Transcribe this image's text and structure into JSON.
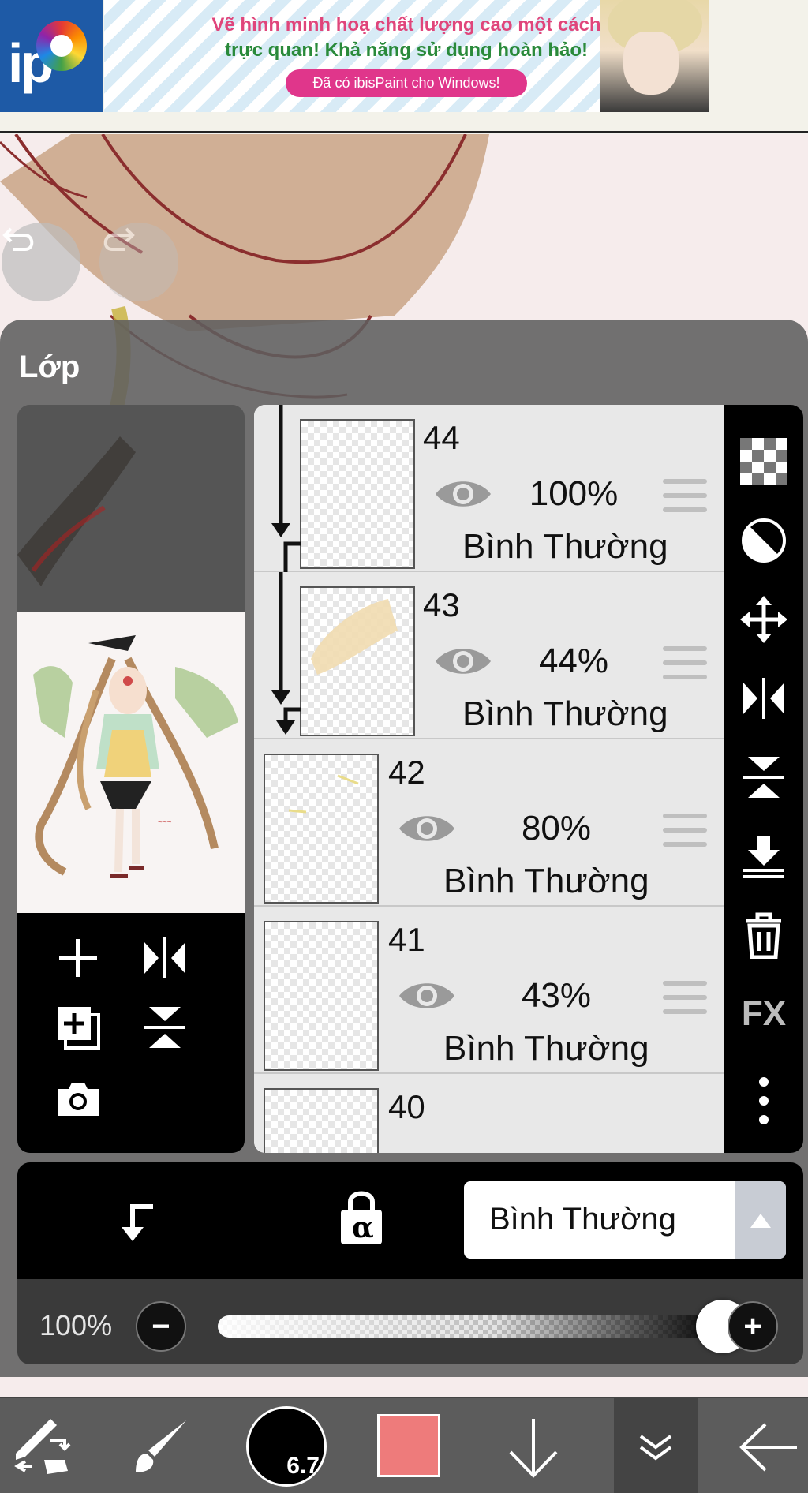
{
  "ad": {
    "line1": "Vẽ hình minh hoạ chất lượng cao một cách",
    "line2": "trực quan! Khả năng sử dụng hoàn hảo!",
    "cta": "Đã có ibisPaint cho Windows!",
    "logo_text": "ip"
  },
  "canvas": {
    "undo_icon": "undo-icon",
    "redo_icon": "redo-icon"
  },
  "layer_panel": {
    "title": "Lớp",
    "layers": [
      {
        "number": "44",
        "opacity": "100%",
        "blend": "Bình Thường",
        "visible": true,
        "clipped": true
      },
      {
        "number": "43",
        "opacity": "44%",
        "blend": "Bình Thường",
        "visible": true,
        "clipped": true
      },
      {
        "number": "42",
        "opacity": "80%",
        "blend": "Bình Thường",
        "visible": true,
        "clipped": false
      },
      {
        "number": "41",
        "opacity": "43%",
        "blend": "Bình Thường",
        "visible": true,
        "clipped": false
      },
      {
        "number": "40",
        "opacity": "",
        "blend": "",
        "visible": true,
        "clipped": false
      }
    ],
    "right_tools": [
      "transparency-icon",
      "mask-icon",
      "move-icon",
      "flip-horizontal-icon",
      "flip-vertical-icon",
      "merge-down-icon",
      "trash-icon",
      "fx-icon",
      "more-icon"
    ],
    "fx_label": "FX",
    "preview_tools": [
      "add-layer-icon",
      "flip-horizontal-icon",
      "duplicate-layer-icon",
      "flip-vertical-icon",
      "camera-icon"
    ]
  },
  "blend_bar": {
    "selected_mode": "Bình Thường",
    "alpha_lock_symbol": "α"
  },
  "opacity_bar": {
    "label": "100%",
    "value_percent": 100,
    "minus": "−",
    "plus": "+"
  },
  "bottom_bar": {
    "brush_size": "6.7",
    "color": "#ee7b7b",
    "tools": [
      "transform-icon",
      "brush-icon",
      "brush-size",
      "color-swatch",
      "arrow-down-icon",
      "layers-toggle-icon",
      "back-arrow-icon"
    ]
  }
}
